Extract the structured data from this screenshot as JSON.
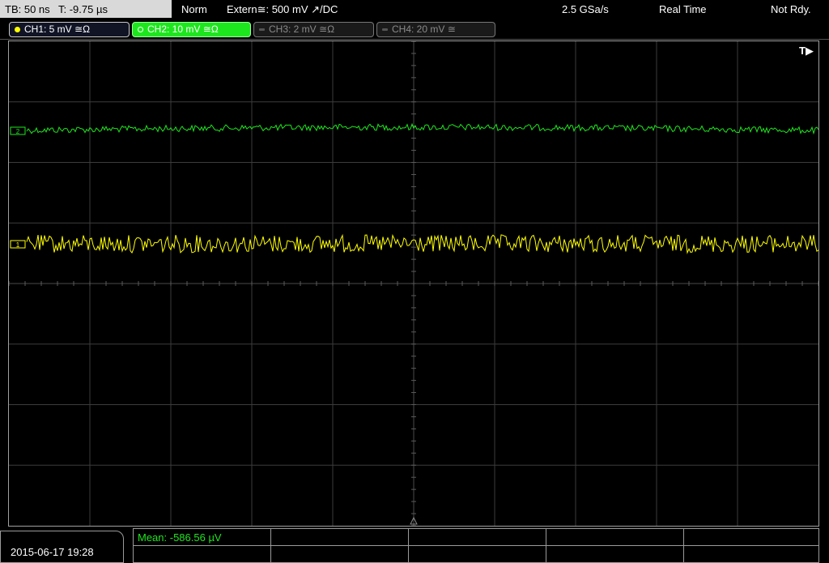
{
  "timebase": {
    "tb_label": "TB: 50 ns",
    "trigger_time_label": "T: -9.75 µs"
  },
  "status": {
    "trigger_mode": "Norm",
    "trigger_source": "Extern≅: 500 mV ↗/DC",
    "sample_rate": "2.5 GSa/s",
    "acquisition_mode": "Real Time",
    "state": "Not Rdy."
  },
  "channels": [
    {
      "label": "CH1: 5 mV ≅Ω",
      "color": "#ffff00",
      "active": true
    },
    {
      "label": "CH2: 10 mV ≅Ω",
      "color": "#1ee61e",
      "active": true,
      "selected": true
    },
    {
      "label": "CH3: 2 mV ≅Ω",
      "color": "#888888",
      "active": false
    },
    {
      "label": "CH4: 20 mV ≅",
      "color": "#888888",
      "active": false
    }
  ],
  "screen": {
    "trigger_marker": "T▶",
    "ch1_marker": "1",
    "ch2_marker": "2"
  },
  "footer": {
    "datetime": "2015-06-17 19:28",
    "measurements": [
      {
        "label": "Mean: -586.56 µV"
      },
      {
        "label": ""
      },
      {
        "label": ""
      },
      {
        "label": ""
      },
      {
        "label": ""
      }
    ]
  }
}
